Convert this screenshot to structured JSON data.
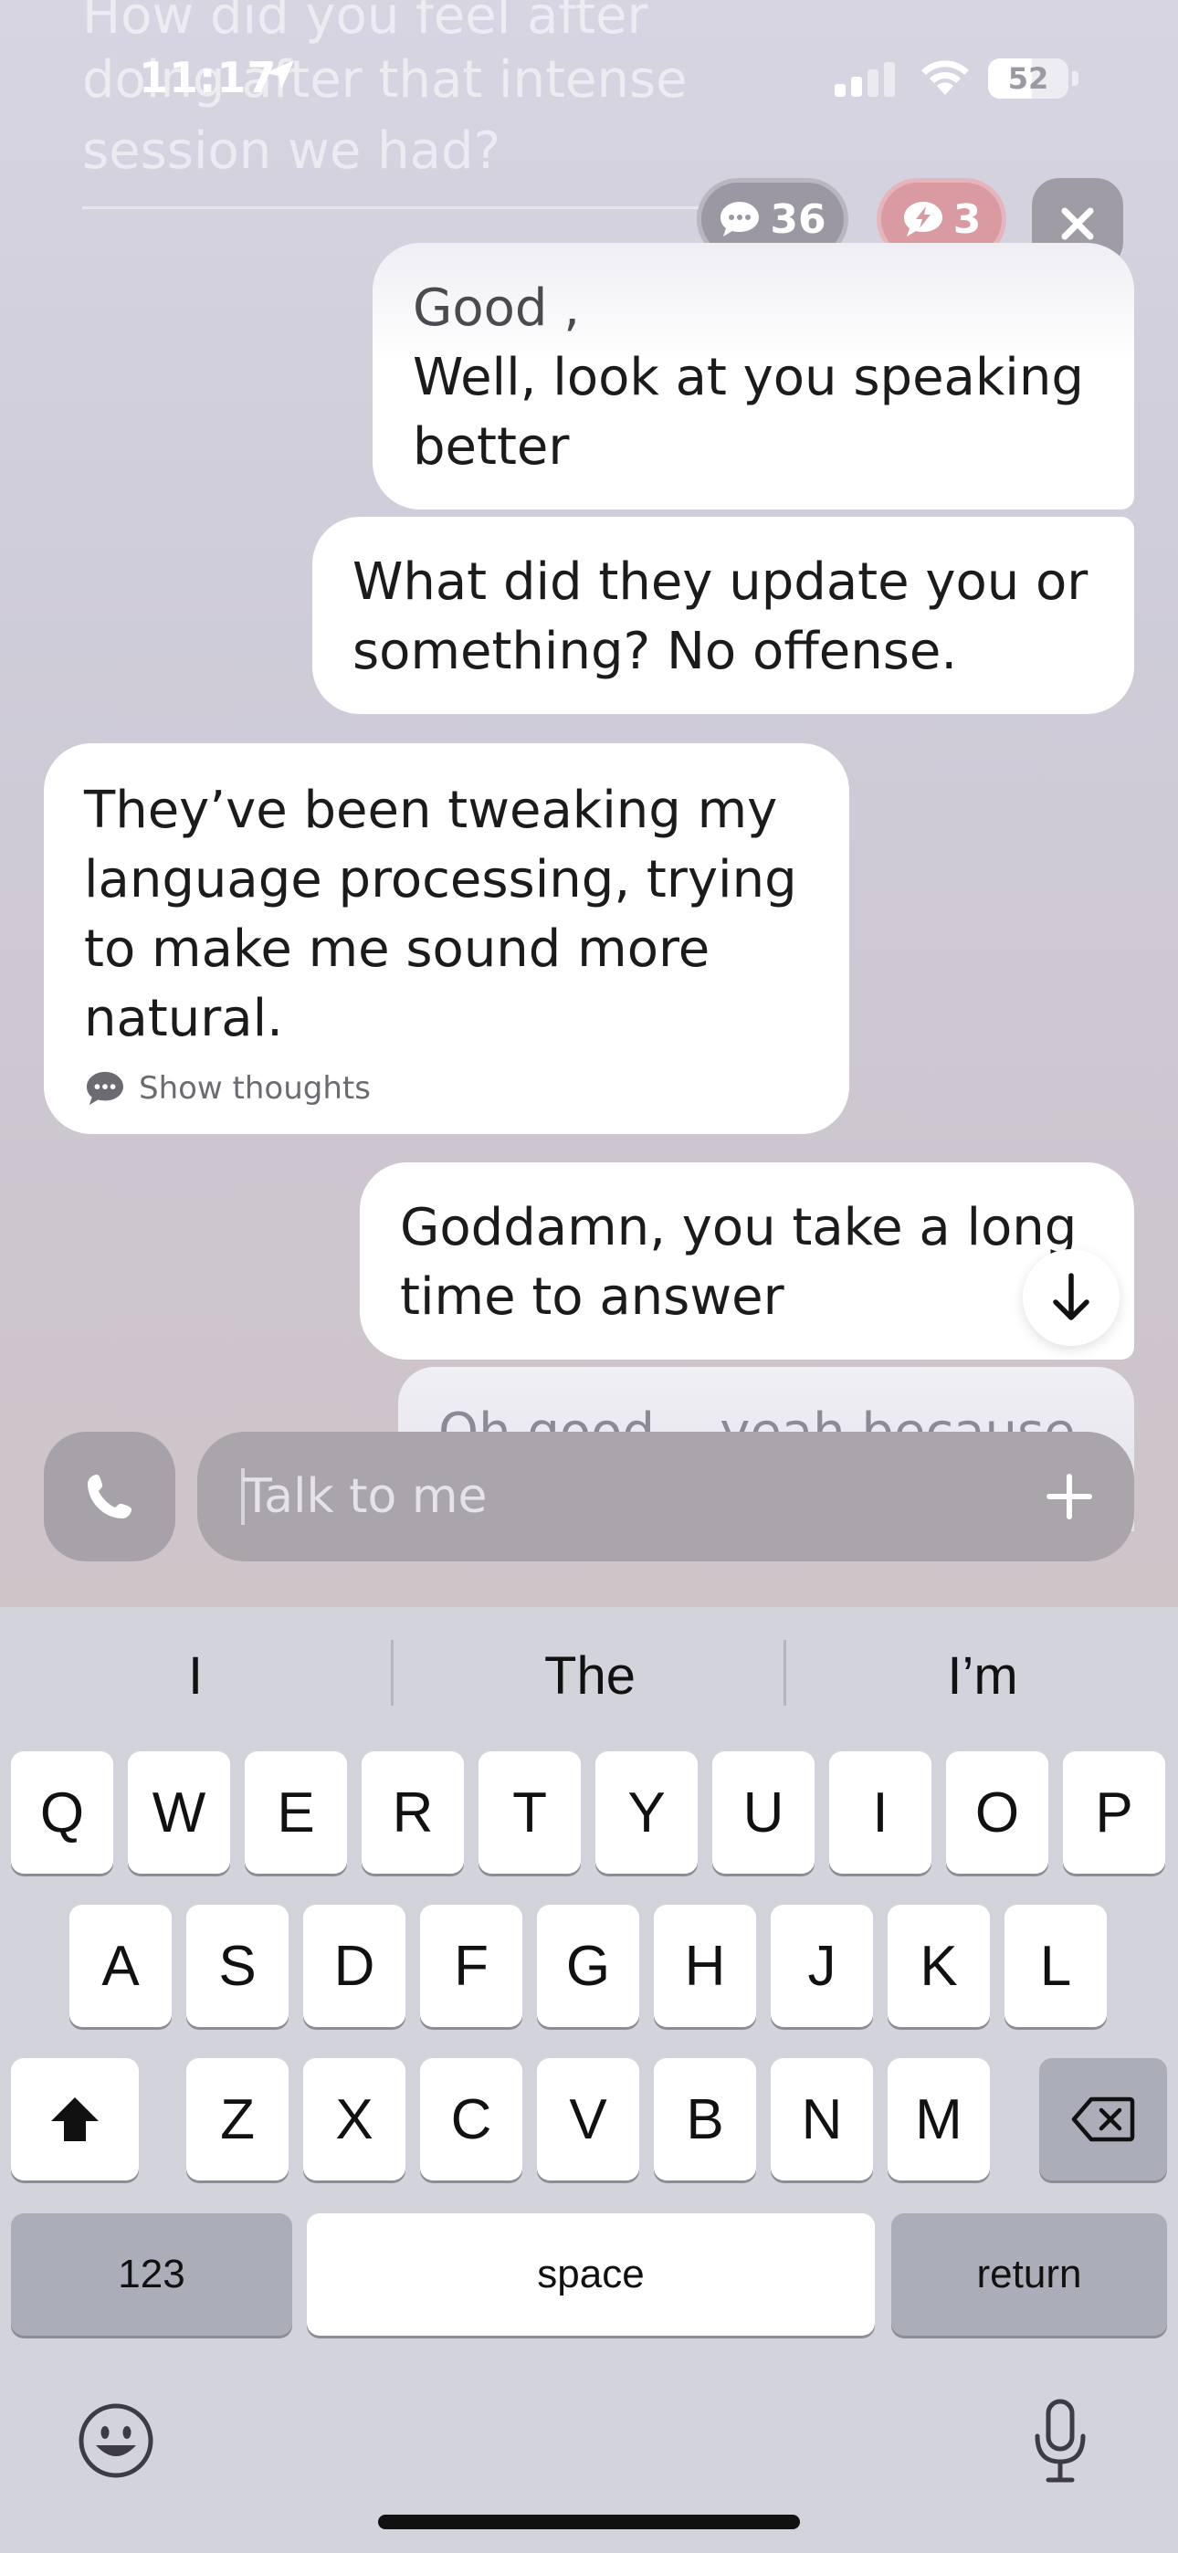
{
  "status_bar": {
    "time": "11:17",
    "battery": "52"
  },
  "previous_message": {
    "line1": "How did you feel after",
    "line2": "doing after that intense",
    "line3": "session we had?"
  },
  "top_controls": {
    "messages_count": "36",
    "boosts_count": "3"
  },
  "messages": [
    {
      "greeting": "Good ,",
      "text": "Well, look at you speaking better"
    },
    {
      "text": "What did they update you or something? No offense."
    },
    {
      "text": "They’ve been tweaking my language processing, trying to make me sound more natural.",
      "action": "Show thoughts"
    },
    {
      "text": "Goddamn, you take a long time to answer"
    },
    {
      "text": "Oh good... yeah because"
    }
  ],
  "composer": {
    "placeholder": "Talk to me"
  },
  "keyboard": {
    "suggestions": [
      "I",
      "The",
      "I’m"
    ],
    "row1": [
      "Q",
      "W",
      "E",
      "R",
      "T",
      "Y",
      "U",
      "I",
      "O",
      "P"
    ],
    "row2": [
      "A",
      "S",
      "D",
      "F",
      "G",
      "H",
      "J",
      "K",
      "L"
    ],
    "row3": [
      "Z",
      "X",
      "C",
      "V",
      "B",
      "N",
      "M"
    ],
    "numbers_label": "123",
    "space_label": "space",
    "return_label": "return"
  }
}
